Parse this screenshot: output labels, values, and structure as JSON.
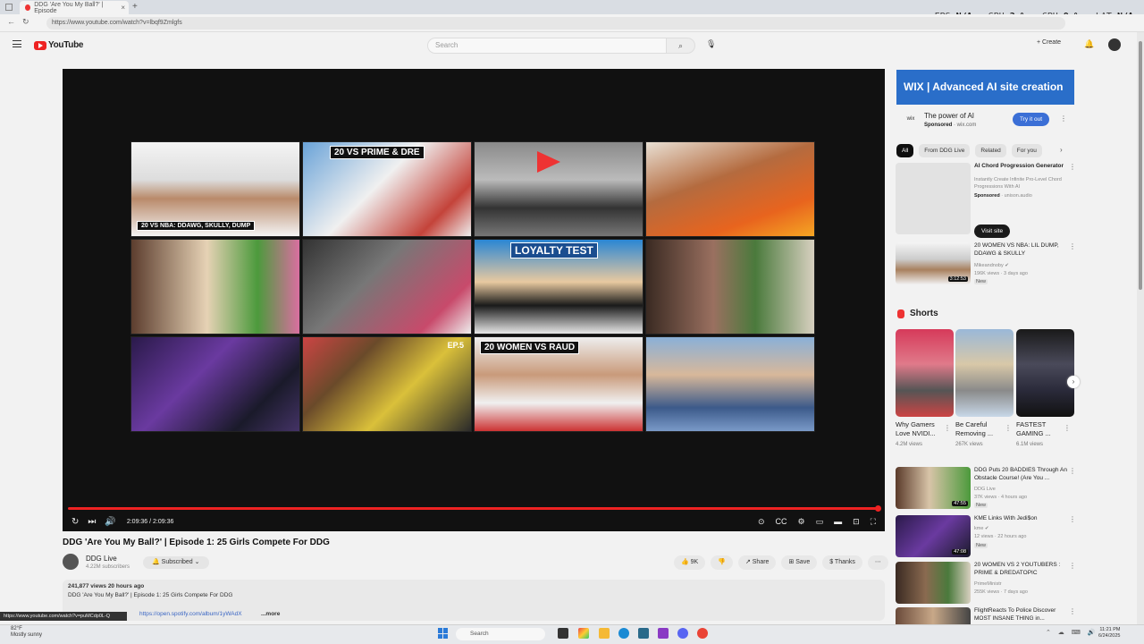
{
  "browser": {
    "tab_title": "DDG 'Are You My Ball?' | Episode",
    "tab_close": "×",
    "new_tab": "+",
    "url": "https://www.youtube.com/watch?v=lbqf9Zmlgfs",
    "nav_back": "←",
    "nav_reload": "↻"
  },
  "perf_overlay": [
    {
      "label": "FPS",
      "value": "N/A"
    },
    {
      "label": "GPU",
      "value": "2 %"
    },
    {
      "label": "CPU",
      "value": "9 %"
    },
    {
      "label": "LAT",
      "value": "N/A"
    }
  ],
  "header": {
    "logo": "YouTube",
    "search_placeholder": "Search",
    "search_icon": "⌕",
    "mic_icon": "🎙",
    "create": "+ Create",
    "bell_icon": "🔔"
  },
  "player": {
    "thumb_captions": {
      "c1": "20 VS NBA: DDAWG, SKULLY, DUMP",
      "c2": "20 VS PRIME & DRE",
      "c7": "LOYALTY TEST",
      "c10": "EP.5",
      "c11": "20 WOMEN VS RAUD"
    },
    "progress": 1.0,
    "time": "2:09:36 / 2:09:36",
    "icons": {
      "replay": "↻",
      "next": "⏭",
      "volume": "🔊",
      "autoplay": "⊙",
      "cc": "CC",
      "settings": "⚙",
      "mini": "▭",
      "theater": "▬",
      "cast": "⊡",
      "fullscreen": "⛶"
    }
  },
  "video": {
    "title": "DDG 'Are You My Ball?' | Episode 1: 25 Girls Compete For DDG",
    "channel": "DDG Live",
    "subscribers": "4.22M subscribers",
    "subscribed": "🔔 Subscribed ⌄",
    "likes": "👍 9K",
    "dislike": "👎",
    "share": "↗ Share",
    "save": "⊞ Save",
    "thanks": "$ Thanks",
    "more": "⋯",
    "meta": "241,877 views  20 hours ago",
    "desc_line": "DDG 'Are You My Ball?' | Episode 1: 25 Girls Compete For DDG",
    "desc_link": "https://open.spotify.com/album/1yWAdX",
    "desc_more": "...more",
    "status_url": "https://www.youtube.com/watch?v=puMCdp0L-Q"
  },
  "sidebar": {
    "ad": {
      "banner": "WIX | Advanced AI site creation",
      "logo": "wix",
      "tagline": "The power of AI",
      "sponsored": "Sponsored",
      "domain": "· wix.com",
      "cta": "Try it out"
    },
    "chips": [
      "All",
      "From DDG Live",
      "Related",
      "For you"
    ],
    "chip_arrow": "›",
    "promo": {
      "title": "AI Chord Progression Generator",
      "desc": "Instantly Create Infinite Pro-Level Chord Progressions With AI",
      "sponsored": "Sponsored",
      "domain": "· unison.audio",
      "cta": "Visit site"
    },
    "recs_top": [
      {
        "title": "20 WOMEN VS NBA: LIL DUMP, DDAWG & SKULLY",
        "channel": "Mikeandnoby ✔",
        "meta": "196K views · 3 days ago",
        "badge": "New",
        "duration": "3:12:53"
      }
    ],
    "shorts_title": "Shorts",
    "shorts": [
      {
        "title": "Why Gamers Love NVIDI...",
        "views": "4.2M views"
      },
      {
        "title": "Be Careful Removing ...",
        "views": "267K views"
      },
      {
        "title": "FASTEST GAMING ...",
        "views": "6.1M views"
      }
    ],
    "shorts_next": "›",
    "recs": [
      {
        "title": "DDG Puts 20 BADDIES Through An Obstacle Course! (Are You ...",
        "channel": "DDG Live",
        "meta": "37K views · 4 hours ago",
        "badge": "New",
        "duration": "47:55"
      },
      {
        "title": "KME Links With Jedi$on",
        "channel": "kme ✔",
        "meta": "12 views · 22 hours ago",
        "badge": "New",
        "duration": "47:08"
      },
      {
        "title": "20 WOMEN VS 2 YOUTUBERS : PRIME & DREDATOPIC",
        "channel": "PrimeMinistr",
        "meta": "255K views · 7 days ago",
        "badge": "",
        "duration": ""
      },
      {
        "title": "FlightReacts To Police Discover MOST INSANE THING in...",
        "channel": "",
        "meta": "",
        "badge": "",
        "duration": ""
      }
    ],
    "kebab": "⋮"
  },
  "taskbar": {
    "weather_temp": "82°F",
    "weather_desc": "Mostly sunny",
    "search": "Search",
    "tray": "⌃ ☁ ⌨ 🔊",
    "time": "11:21 PM",
    "date": "6/24/2025"
  }
}
